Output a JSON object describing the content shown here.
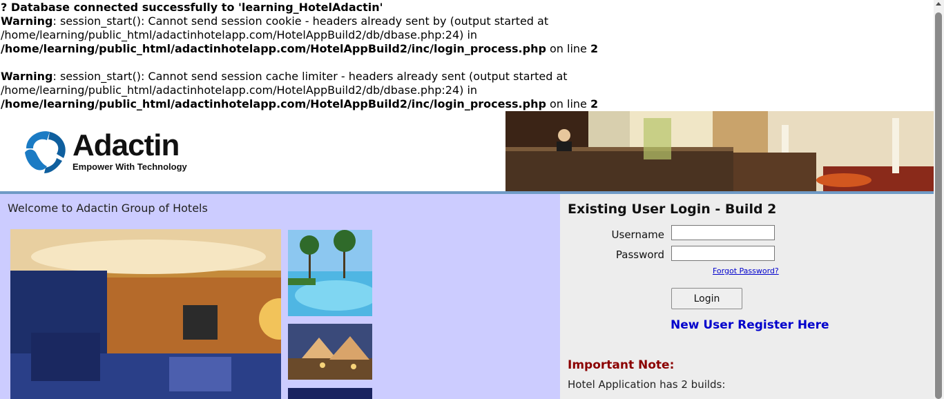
{
  "php_messages": {
    "db_line": "? Database connected successfully to 'learning_HotelAdactin'",
    "warnings": [
      {
        "label": "Warning",
        "message": ": session_start(): Cannot send session cookie - headers already sent by (output started at",
        "origin": "/home/learning/public_html/adactinhotelapp.com/HotelAppBuild2/db/dbase.php:24) in",
        "file": "/home/learning/public_html/adactinhotelapp.com/HotelAppBuild2/inc/login_process.php",
        "on_line": " on line ",
        "line_no": "2"
      },
      {
        "label": "Warning",
        "message": ": session_start(): Cannot send session cache limiter - headers already sent (output started at",
        "origin": "/home/learning/public_html/adactinhotelapp.com/HotelAppBuild2/db/dbase.php:24) in",
        "file": "/home/learning/public_html/adactinhotelapp.com/HotelAppBuild2/inc/login_process.php",
        "on_line": " on line ",
        "line_no": "2"
      }
    ]
  },
  "header": {
    "logo_name": "Adactin",
    "logo_tagline": "Empower With Technology",
    "logo_icon": "adactin-swirl-icon"
  },
  "left_panel": {
    "welcome": "Welcome to Adactin Group of Hotels"
  },
  "login": {
    "title": "Existing User Login - Build 2",
    "username_label": "Username",
    "username_value": "",
    "password_label": "Password",
    "password_value": "",
    "forgot_link": "Forgot Password?",
    "login_button": "Login",
    "register_link": "New User Register Here"
  },
  "note": {
    "title": "Important Note:",
    "text": "Hotel Application has 2 builds:"
  },
  "colors": {
    "left_bg": "#ccccff",
    "right_bg": "#ededed",
    "link_blue": "#0000cc",
    "note_red": "#8b0000",
    "band": "#6f9ac6"
  }
}
